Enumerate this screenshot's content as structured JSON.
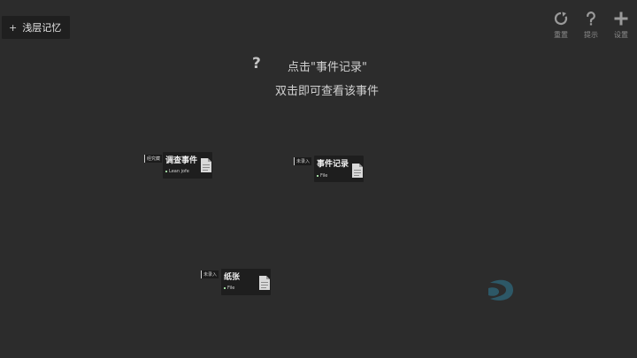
{
  "tab": {
    "plus": "+",
    "label": "浅层记忆"
  },
  "toolbar": {
    "reset_label": "重置",
    "hint_label": "提示",
    "settings_label": "设置"
  },
  "hint": {
    "icon": "?",
    "line1": "点击\"事件记录\"",
    "line2": "双击即可查看该事件"
  },
  "nodes": [
    {
      "tag": "经究藏",
      "title": "调查事件",
      "sub": "Lean jofe"
    },
    {
      "tag": "未录入",
      "title": "事件记录",
      "sub": "File"
    },
    {
      "tag": "未录入",
      "title": "纸张",
      "sub": "File"
    }
  ],
  "colors": {
    "background": "#2c2c2c",
    "card": "#1e1e1e",
    "text": "#d8d8d8",
    "muted": "#8c8c8c",
    "accent_dot": "#9fd89f",
    "watermark": "#2f8fb0"
  }
}
